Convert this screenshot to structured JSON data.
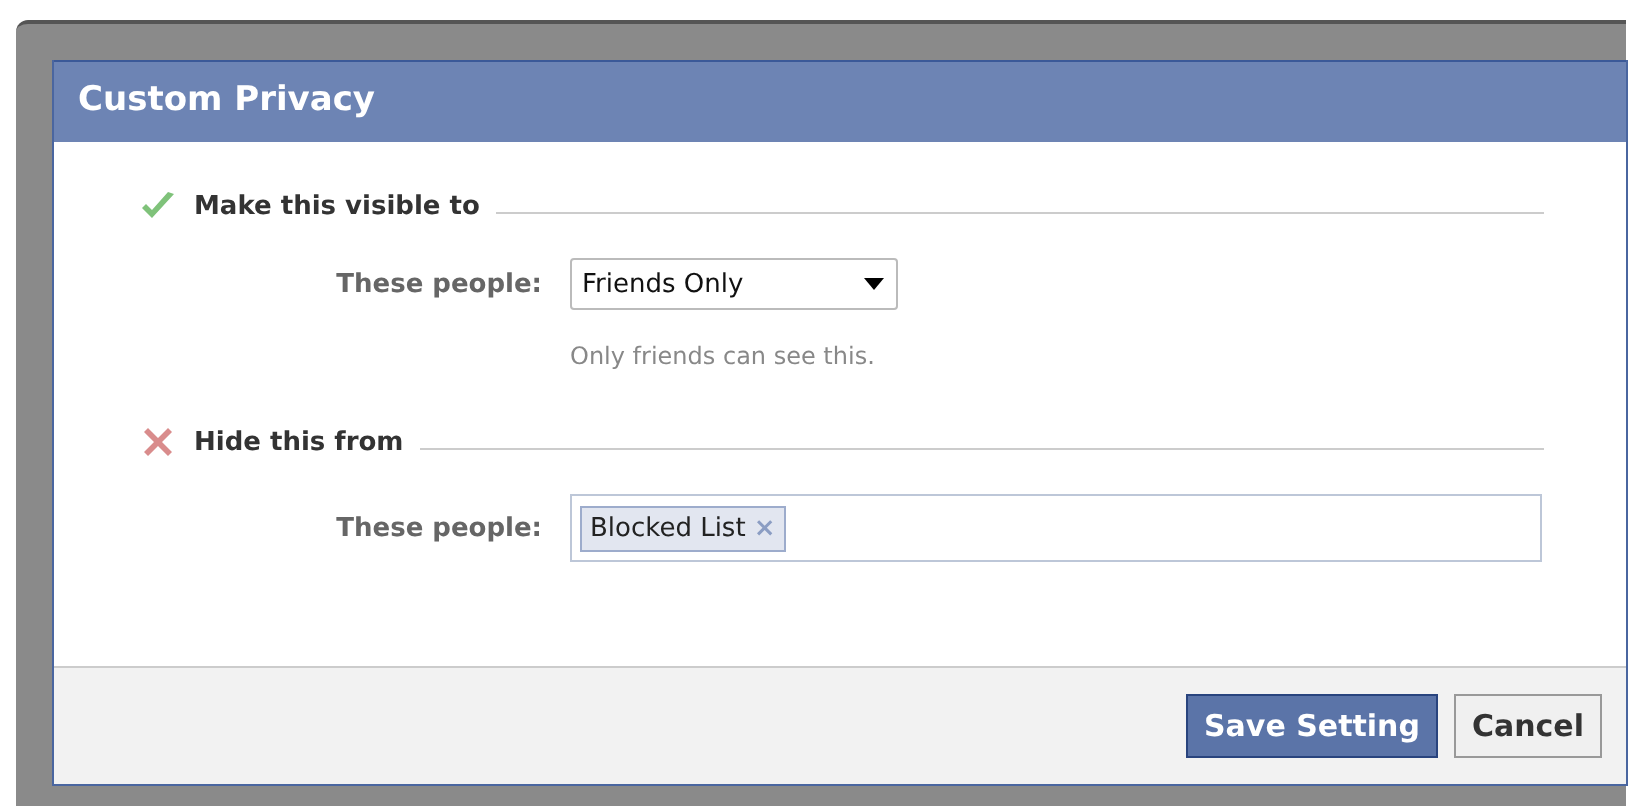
{
  "dialog": {
    "title": "Custom Privacy"
  },
  "sections": [
    {
      "kind": "allow",
      "heading": "Make this visible to",
      "label": "These people:",
      "field": {
        "kind": "select",
        "value": "Friends Only"
      },
      "hint": "Only friends can see this."
    },
    {
      "kind": "deny",
      "heading": "Hide this from",
      "label": "These people:",
      "field": {
        "kind": "tokens",
        "tokens": [
          "Blocked List"
        ],
        "remove_glyph": "×"
      }
    }
  ],
  "buttons": [
    {
      "label": "Save Setting",
      "kind": "primary"
    },
    {
      "label": "Cancel",
      "kind": "secondary"
    }
  ]
}
